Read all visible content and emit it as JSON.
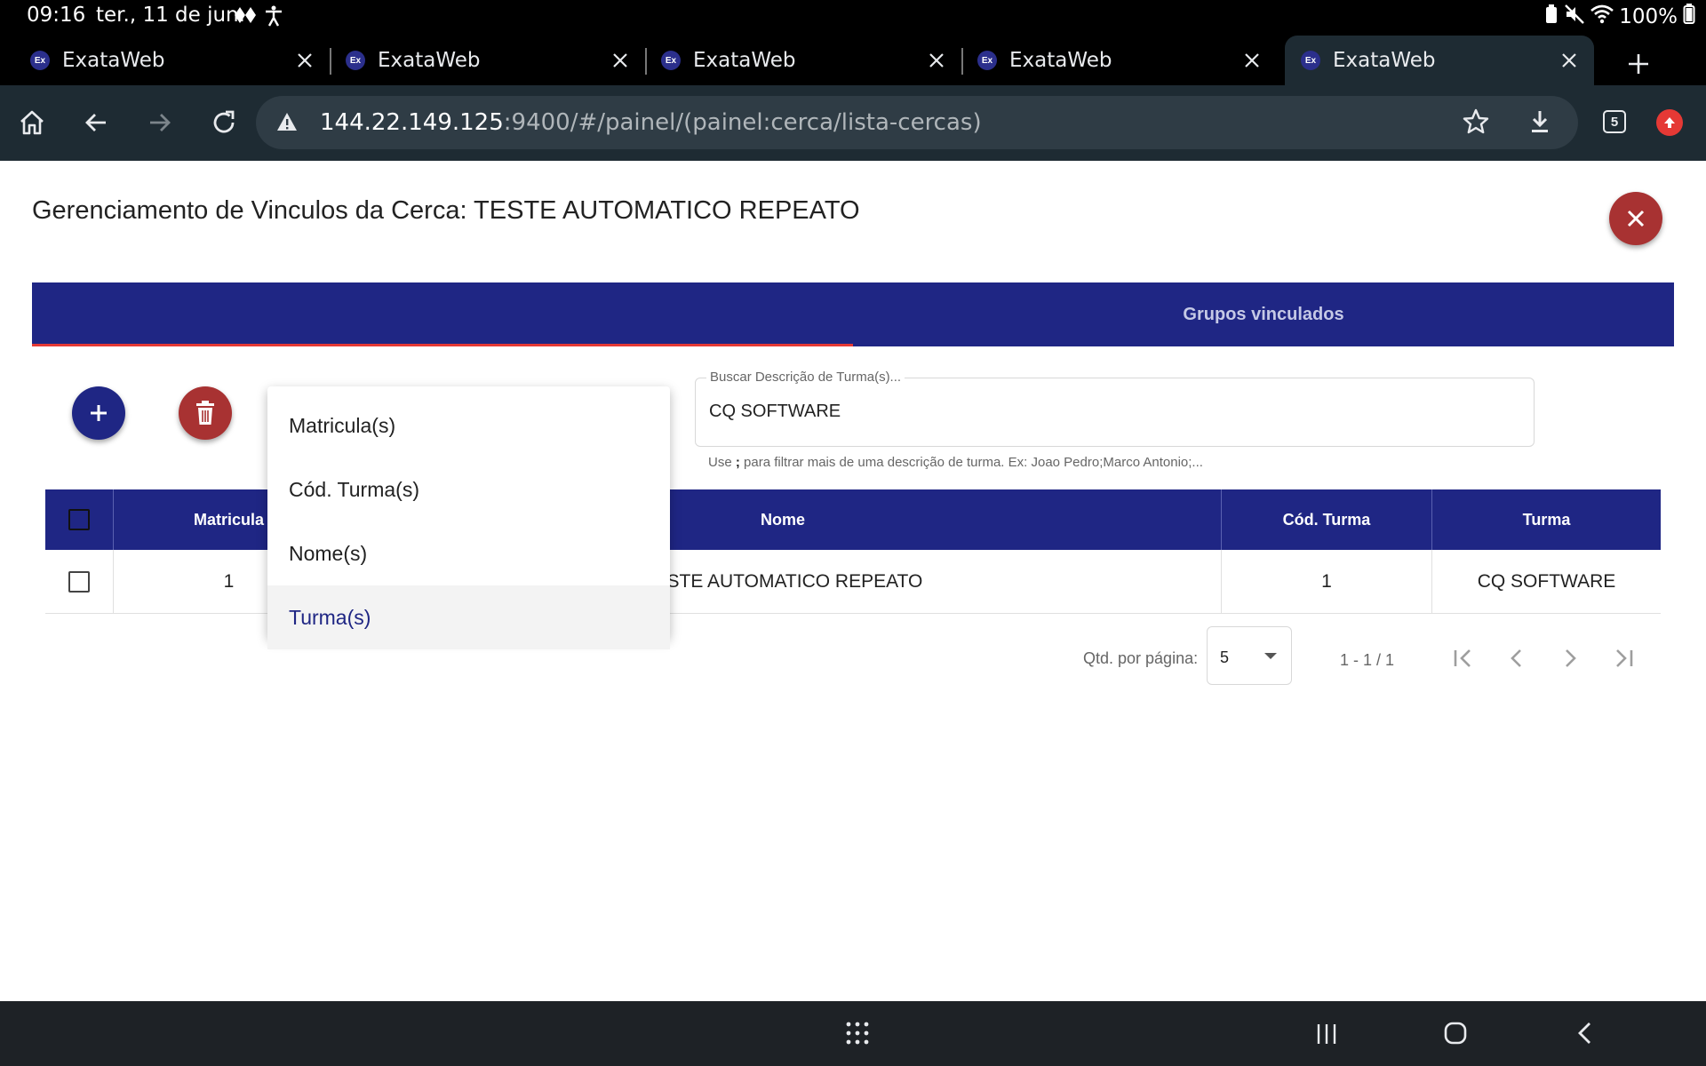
{
  "status_bar": {
    "time": "09:16",
    "date": "ter., 11 de jun.",
    "battery": "100%"
  },
  "browser": {
    "tabs": [
      {
        "title": "ExataWeb",
        "favicon": "Ex"
      },
      {
        "title": "ExataWeb",
        "favicon": "Ex"
      },
      {
        "title": "ExataWeb",
        "favicon": "Ex"
      },
      {
        "title": "ExataWeb",
        "favicon": "Ex"
      },
      {
        "title": "ExataWeb",
        "favicon": "Ex"
      }
    ],
    "active_tab": 4,
    "url_host": "144.22.149.125",
    "url_rest": ":9400/#/painel/(painel:cerca/lista-cercas)",
    "tab_count": "5"
  },
  "page": {
    "title": "Gerenciamento de Vinculos da Cerca: TESTE AUTOMATICO REPEATO",
    "tabs": [
      "Grupos vinculados"
    ],
    "search": {
      "label": "Buscar Descrição de Turma(s)...",
      "value": "CQ SOFTWARE",
      "hint_prefix": "Use ",
      "hint_key": ";",
      "hint_suffix": " para filtrar mais de uma descrição de turma. Ex: Joao Pedro;Marco Antonio;..."
    },
    "filter_menu": {
      "items": [
        "Matricula(s)",
        "Cód. Turma(s)",
        "Nome(s)",
        "Turma(s)"
      ],
      "selected": "Turma(s)"
    },
    "table": {
      "columns": [
        "Matricula",
        "Nome",
        "Cód. Turma",
        "Turma"
      ],
      "rows": [
        {
          "matricula": "1",
          "nome": "TESTE AUTOMATICO REPEATO",
          "cod_turma": "1",
          "turma": "CQ SOFTWARE"
        }
      ]
    },
    "pagination": {
      "per_page_label": "Qtd. por página:",
      "per_page_value": "5",
      "range": "1 - 1 / 1"
    }
  },
  "colors": {
    "primary": "#1f2684",
    "danger": "#a83232",
    "tab_ink": "#e53935"
  }
}
